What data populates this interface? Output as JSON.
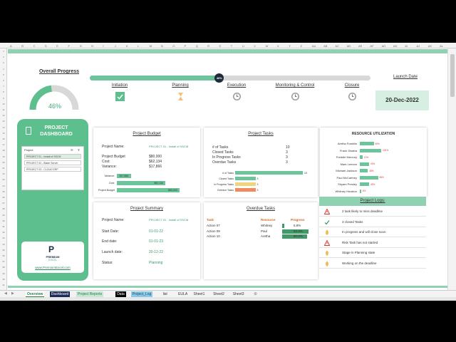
{
  "columns": [
    "A",
    "B",
    "C",
    "D",
    "E",
    "F",
    "G",
    "H",
    "I",
    "J",
    "K",
    "L",
    "M",
    "N",
    "O",
    "P",
    "Q",
    "R",
    "S",
    "T",
    "U",
    "V",
    "W",
    "X",
    "Y",
    "Z",
    "AA",
    "AB",
    "AC",
    "AD",
    "AE",
    "AF",
    "AG",
    "AH",
    "AI",
    "AJ",
    "AK",
    "AL"
  ],
  "rows": [
    "1",
    "2",
    "3",
    "4",
    "5",
    "6",
    "7",
    "8",
    "9",
    "10",
    "11",
    "12",
    "13",
    "14",
    "15",
    "16",
    "17",
    "18",
    "19",
    "20",
    "21",
    "22",
    "23",
    "24",
    "25",
    "26",
    "27",
    "28",
    "29",
    "30",
    "31",
    "32",
    "33",
    "34",
    "35",
    "36",
    "37",
    "38",
    "39",
    "40",
    "41"
  ],
  "overall_progress": {
    "title": "Overall Progress",
    "value": "46%",
    "fraction": 0.46
  },
  "timeline": {
    "value_label": "46%",
    "fraction": 0.46
  },
  "phases": [
    {
      "name": "Initiation",
      "icon": "check-icon"
    },
    {
      "name": "Planning",
      "icon": "hourglass-icon"
    },
    {
      "name": "Execution",
      "icon": "clock-icon"
    },
    {
      "name": "Monitoring & Control",
      "icon": "clock-icon"
    },
    {
      "name": "Closure",
      "icon": "clock-icon"
    }
  ],
  "launch": {
    "title": "Launch Date",
    "date": "20-Dec-2022"
  },
  "dashboard": {
    "title_line1": "PROJECT",
    "title_line2": "DASHBOARD",
    "slicer_header": "Project",
    "slicer_items": [
      "PROJECT 01 - Install of SSCM",
      "PROJECT 02 - Blade Server",
      "PROJECT 03 - CLOUD ERP"
    ],
    "logo_letter": "P",
    "logo_line1": "PREMIUM",
    "logo_line2": "EXCEL",
    "url": "www.PremiumExcel.com"
  },
  "budget": {
    "title": "Project Budget",
    "name_label": "Project Name:",
    "name_value": "PROJECT 01 - Install of SSCM",
    "budget_label": "Project Budget",
    "budget_value": "$80,000",
    "cost_label": "Cost:",
    "cost_value": "$62,134",
    "variance_label": "Variance:",
    "variance_value": "$17,866",
    "chart": [
      {
        "label": "Variance:",
        "value": 17866,
        "text": "$17,866"
      },
      {
        "label": "Cost:",
        "value": 62134,
        "text": "$62,134"
      },
      {
        "label": "Project Budget",
        "value": 80000,
        "text": "$80,000"
      }
    ]
  },
  "tasks": {
    "title": "Project Tasks",
    "rows": [
      {
        "label": "# of Tasks",
        "value": "10"
      },
      {
        "label": "Closed Tasks",
        "value": "3"
      },
      {
        "label": "In Progress Tasks",
        "value": "3"
      },
      {
        "label": "Overdue Tasks",
        "value": "3"
      }
    ],
    "chart": [
      {
        "label": "# of Tasks",
        "value": 10,
        "color": "#6cc49a"
      },
      {
        "label": "Closed Tasks",
        "value": 3,
        "color": "#6cc49a"
      },
      {
        "label": "In Progress Tasks",
        "value": 3,
        "color": "#f2d27a"
      },
      {
        "label": "Overdue Tasks",
        "value": 3,
        "color": "#f08a5d"
      }
    ]
  },
  "resources": {
    "title": "RESOURCE UTILIZATION",
    "rows": [
      {
        "name": "Aretha Franklin",
        "pct": 65,
        "text": "65%"
      },
      {
        "name": "Frank Sinatra",
        "pct": 100,
        "text": "100%"
      },
      {
        "name": "Freddie Mercury",
        "pct": 13,
        "text": "13%"
      },
      {
        "name": "Mark Lennon",
        "pct": 43,
        "text": "43%"
      },
      {
        "name": "Michael Jackson",
        "pct": 38,
        "text": "38%"
      },
      {
        "name": "Paul McCartney",
        "pct": 85,
        "text": "85%"
      },
      {
        "name": "Shyam Presley",
        "pct": 43,
        "text": "43%"
      },
      {
        "name": "Whitney Houston",
        "pct": 6,
        "text": "6%"
      }
    ]
  },
  "summary": {
    "title": "Project Summary",
    "rows": [
      {
        "label": "Project Name:",
        "value": "PROJECT 01 - Install of SSCM"
      },
      {
        "label": "Start Date:",
        "value": "01-01-22"
      },
      {
        "label": "End date:",
        "value": "01-01-23"
      },
      {
        "label": "Launch date:",
        "value": "20-12-22"
      },
      {
        "label": "Status:",
        "value": "Planning"
      }
    ]
  },
  "overdue": {
    "title": "Overdue Tasks",
    "headers": {
      "task": "Task",
      "resource": "Resource",
      "progress": "Progress"
    },
    "rows": [
      {
        "task": "Action 07",
        "resource": "Whitney",
        "progress": "5.8%",
        "fraction": 0.058
      },
      {
        "task": "Action 09",
        "resource": "Paul",
        "progress": "83.3%",
        "fraction": 0.833
      },
      {
        "task": "Action 10",
        "resource": "Aretha",
        "progress": "80.0%",
        "fraction": 0.8
      }
    ]
  },
  "logs": {
    "title": "Project Logs:",
    "rows": [
      {
        "icon": "warning-icon",
        "text": "2 task likely to miss deadline"
      },
      {
        "icon": "check-icon",
        "text": "3 closed Tasks"
      },
      {
        "icon": "info-icon",
        "text": "In progress and will close soon"
      },
      {
        "icon": "warning-icon",
        "text": "Risk Task has not started"
      },
      {
        "icon": "info-icon",
        "text": "Stage in Planning state"
      },
      {
        "icon": "info-icon",
        "text": "Working on the deadline"
      }
    ]
  },
  "tabs": [
    {
      "label": "Overview",
      "bg": "#ffffff",
      "fg": "#2a7a4a",
      "active": true
    },
    {
      "label": "Dashboard",
      "bg": "#1d2b5a",
      "fg": "#ffffff"
    },
    {
      "label": "Project Reports",
      "bg": "#c7e9d3",
      "fg": "#2a7a4a"
    },
    {
      "label": "Data",
      "bg": "#000000",
      "fg": "#ffffff"
    },
    {
      "label": "Project_Log",
      "bg": "#8ccbe8",
      "fg": "#1d4a6a"
    },
    {
      "label": "list",
      "bg": "#f3f3f3",
      "fg": "#333333"
    },
    {
      "label": "EULA",
      "bg": "#f3f3f3",
      "fg": "#333333"
    },
    {
      "label": "Sheet1",
      "bg": "#f3f3f3",
      "fg": "#333333"
    },
    {
      "label": "Sheet2",
      "bg": "#f3f3f3",
      "fg": "#333333"
    },
    {
      "label": "Sheet3",
      "bg": "#f3f3f3",
      "fg": "#333333"
    }
  ],
  "colors": {
    "accent": "#5ebf8e",
    "accent_light": "#8fd1b0",
    "navy": "#1d2b3a",
    "warn": "#d33333"
  }
}
